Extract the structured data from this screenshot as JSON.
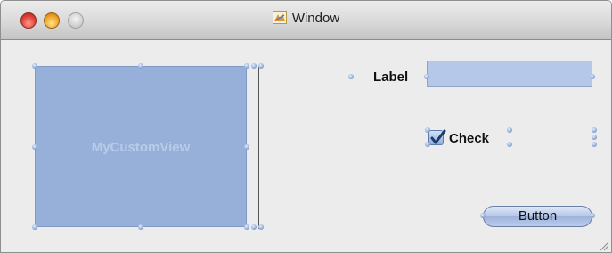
{
  "window": {
    "title": "Window"
  },
  "controls": {
    "custom_view_label": "MyCustomView",
    "label_text": "Label",
    "text_field_value": "",
    "checkbox_label": "Check",
    "checkbox_checked": true,
    "button_label": "Button"
  },
  "icons": {
    "close": "close-icon",
    "minimize": "minimize-icon",
    "zoom": "zoom-icon",
    "title": "app-icon",
    "checkmark": "checkmark-icon",
    "resize": "resize-grip-icon"
  },
  "colors": {
    "selection_blue": "#96b0d9",
    "field_blue": "#b5c8ea",
    "window_bg": "#ececec"
  }
}
